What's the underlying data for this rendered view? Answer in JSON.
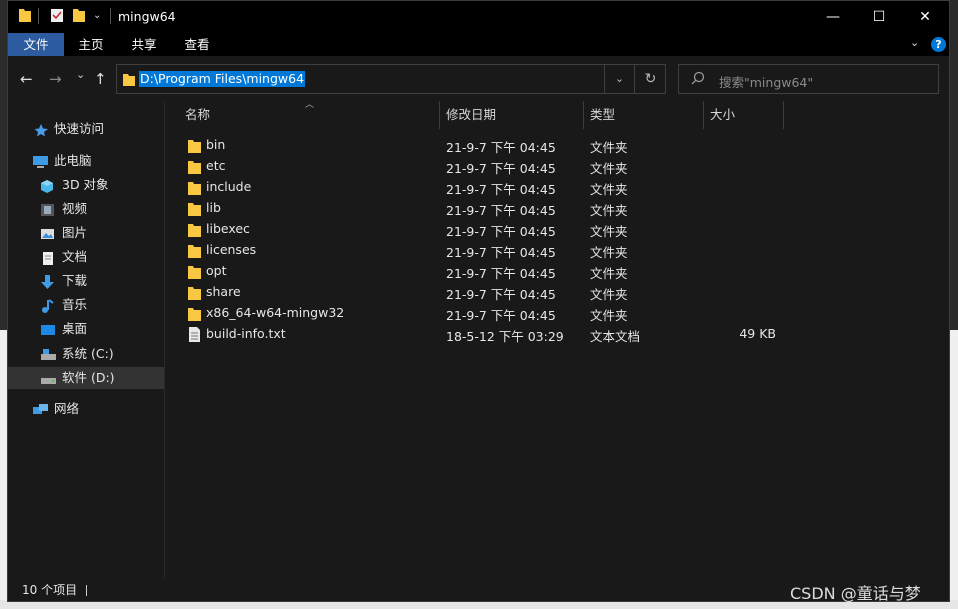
{
  "window": {
    "title": "mingw64",
    "controls": {
      "minimize": "—",
      "maximize": "☐",
      "close": "✕"
    }
  },
  "ribbon": {
    "tabs": [
      {
        "label": "文件",
        "active": true
      },
      {
        "label": "主页",
        "active": false
      },
      {
        "label": "共享",
        "active": false
      },
      {
        "label": "查看",
        "active": false
      }
    ],
    "help_icon": "?"
  },
  "nav": {
    "back_icon": "←",
    "forward_icon": "→",
    "recent_icon": "⌄",
    "up_icon": "↑"
  },
  "address": {
    "path": "D:\\Program Files\\mingw64",
    "dropdown_icon": "⌄",
    "refresh_icon": "↻"
  },
  "search": {
    "placeholder": "搜索\"mingw64\""
  },
  "sidebar": {
    "items": [
      {
        "label": "快速访问",
        "icon": "star-icon"
      },
      {
        "label": "此电脑",
        "icon": "computer-icon"
      },
      {
        "label": "3D 对象",
        "icon": "cube-icon"
      },
      {
        "label": "视频",
        "icon": "video-icon"
      },
      {
        "label": "图片",
        "icon": "picture-icon"
      },
      {
        "label": "文档",
        "icon": "document-icon"
      },
      {
        "label": "下载",
        "icon": "download-icon"
      },
      {
        "label": "音乐",
        "icon": "music-icon"
      },
      {
        "label": "桌面",
        "icon": "desktop-icon"
      },
      {
        "label": "系统 (C:)",
        "icon": "drive-icon"
      },
      {
        "label": "软件 (D:)",
        "icon": "drive-icon"
      },
      {
        "label": "网络",
        "icon": "network-icon"
      }
    ]
  },
  "columns": {
    "name": "名称",
    "modified": "修改日期",
    "type": "类型",
    "size": "大小"
  },
  "files": [
    {
      "name": "bin",
      "modified": "21-9-7 下午 04:45",
      "type": "文件夹",
      "size": ""
    },
    {
      "name": "etc",
      "modified": "21-9-7 下午 04:45",
      "type": "文件夹",
      "size": ""
    },
    {
      "name": "include",
      "modified": "21-9-7 下午 04:45",
      "type": "文件夹",
      "size": ""
    },
    {
      "name": "lib",
      "modified": "21-9-7 下午 04:45",
      "type": "文件夹",
      "size": ""
    },
    {
      "name": "libexec",
      "modified": "21-9-7 下午 04:45",
      "type": "文件夹",
      "size": ""
    },
    {
      "name": "licenses",
      "modified": "21-9-7 下午 04:45",
      "type": "文件夹",
      "size": ""
    },
    {
      "name": "opt",
      "modified": "21-9-7 下午 04:45",
      "type": "文件夹",
      "size": ""
    },
    {
      "name": "share",
      "modified": "21-9-7 下午 04:45",
      "type": "文件夹",
      "size": ""
    },
    {
      "name": "x86_64-w64-mingw32",
      "modified": "21-9-7 下午 04:45",
      "type": "文件夹",
      "size": ""
    },
    {
      "name": "build-info.txt",
      "modified": "18-5-12 下午 03:29",
      "type": "文本文档",
      "size": "49 KB"
    }
  ],
  "status": {
    "count": "10 个项目"
  },
  "watermark": "CSDN @童话与梦",
  "colors": {
    "accent": "#0078d7",
    "ribbon_active": "#2d5ba0",
    "folder": "#f8c843",
    "background": "#191919"
  }
}
